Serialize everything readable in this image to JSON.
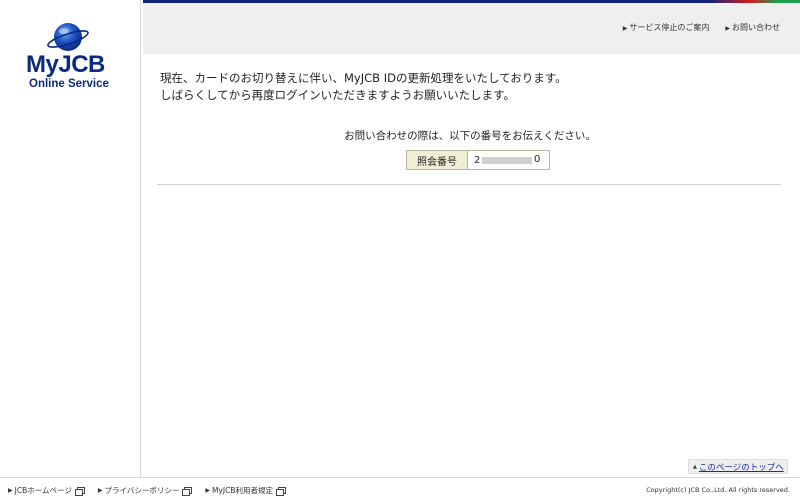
{
  "brand": {
    "logo_main": "MyJCB",
    "logo_sub": "Online Service"
  },
  "colors": {
    "brand_blue": "#0a2a80",
    "header_bg": "#efefef",
    "label_bg": "#f0efd6",
    "link_blue": "#1a2c9a"
  },
  "header": {
    "links": [
      {
        "label": "サービス停止のご案内",
        "icon": "triangle-right-icon"
      },
      {
        "label": "お問い合わせ",
        "icon": "triangle-right-icon"
      }
    ]
  },
  "main": {
    "message_line1": "現在、カードのお切り替えに伴い、MyJCB IDの更新処理をいたしております。",
    "message_line2": "しばらくしてから再度ログインいただきますようお願いいたします。",
    "inquiry_note": "お問い合わせの際は、以下の番号をお伝えください。",
    "inquiry_label": "照会番号",
    "inquiry_value_start": "2",
    "inquiry_value_end": "0"
  },
  "page_top": {
    "label": "このページのトップへ"
  },
  "footer": {
    "links": [
      {
        "label": "JCBホームページ",
        "icon": "external-window-icon"
      },
      {
        "label": "プライバシーポリシー",
        "icon": "external-window-icon"
      },
      {
        "label": "MyJCB利用者規定",
        "icon": "external-window-icon"
      }
    ],
    "copyright": "Copyright(c) JCB Co.,Ltd. All rights reserved."
  }
}
